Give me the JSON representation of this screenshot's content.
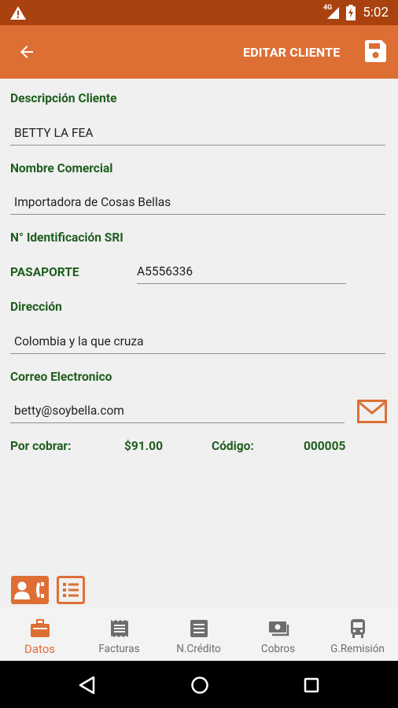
{
  "status_bar": {
    "network": "4G",
    "time": "5:02"
  },
  "app_bar": {
    "title": "EDITAR CLIENTE"
  },
  "form": {
    "descripcion_label": "Descripción Cliente",
    "descripcion_value": "BETTY LA FEA",
    "nombre_label": "Nombre Comercial",
    "nombre_value": "Importadora de Cosas Bellas",
    "identificacion_label": "N° Identificación SRI",
    "id_type": "PASAPORTE",
    "id_value": "A5556336",
    "direccion_label": "Dirección",
    "direccion_value": "Colombia y la que cruza",
    "correo_label": "Correo Electronico",
    "correo_value": "betty@soybella.com"
  },
  "summary": {
    "por_cobrar_label": "Por cobrar:",
    "por_cobrar_value": "$91.00",
    "codigo_label": "Código:",
    "codigo_value": "000005"
  },
  "bottom_nav": {
    "items": [
      {
        "label": "Datos",
        "icon": "briefcase-icon",
        "active": true
      },
      {
        "label": "Facturas",
        "icon": "invoice-icon",
        "active": false
      },
      {
        "label": "N.Crédito",
        "icon": "credit-note-icon",
        "active": false
      },
      {
        "label": "Cobros",
        "icon": "payments-icon",
        "active": false
      },
      {
        "label": "G.Remisión",
        "icon": "bus-icon",
        "active": false
      }
    ]
  },
  "colors": {
    "primary": "#dd6f35",
    "primary_dark": "#a9420f",
    "label_green": "#1f5e1f"
  }
}
